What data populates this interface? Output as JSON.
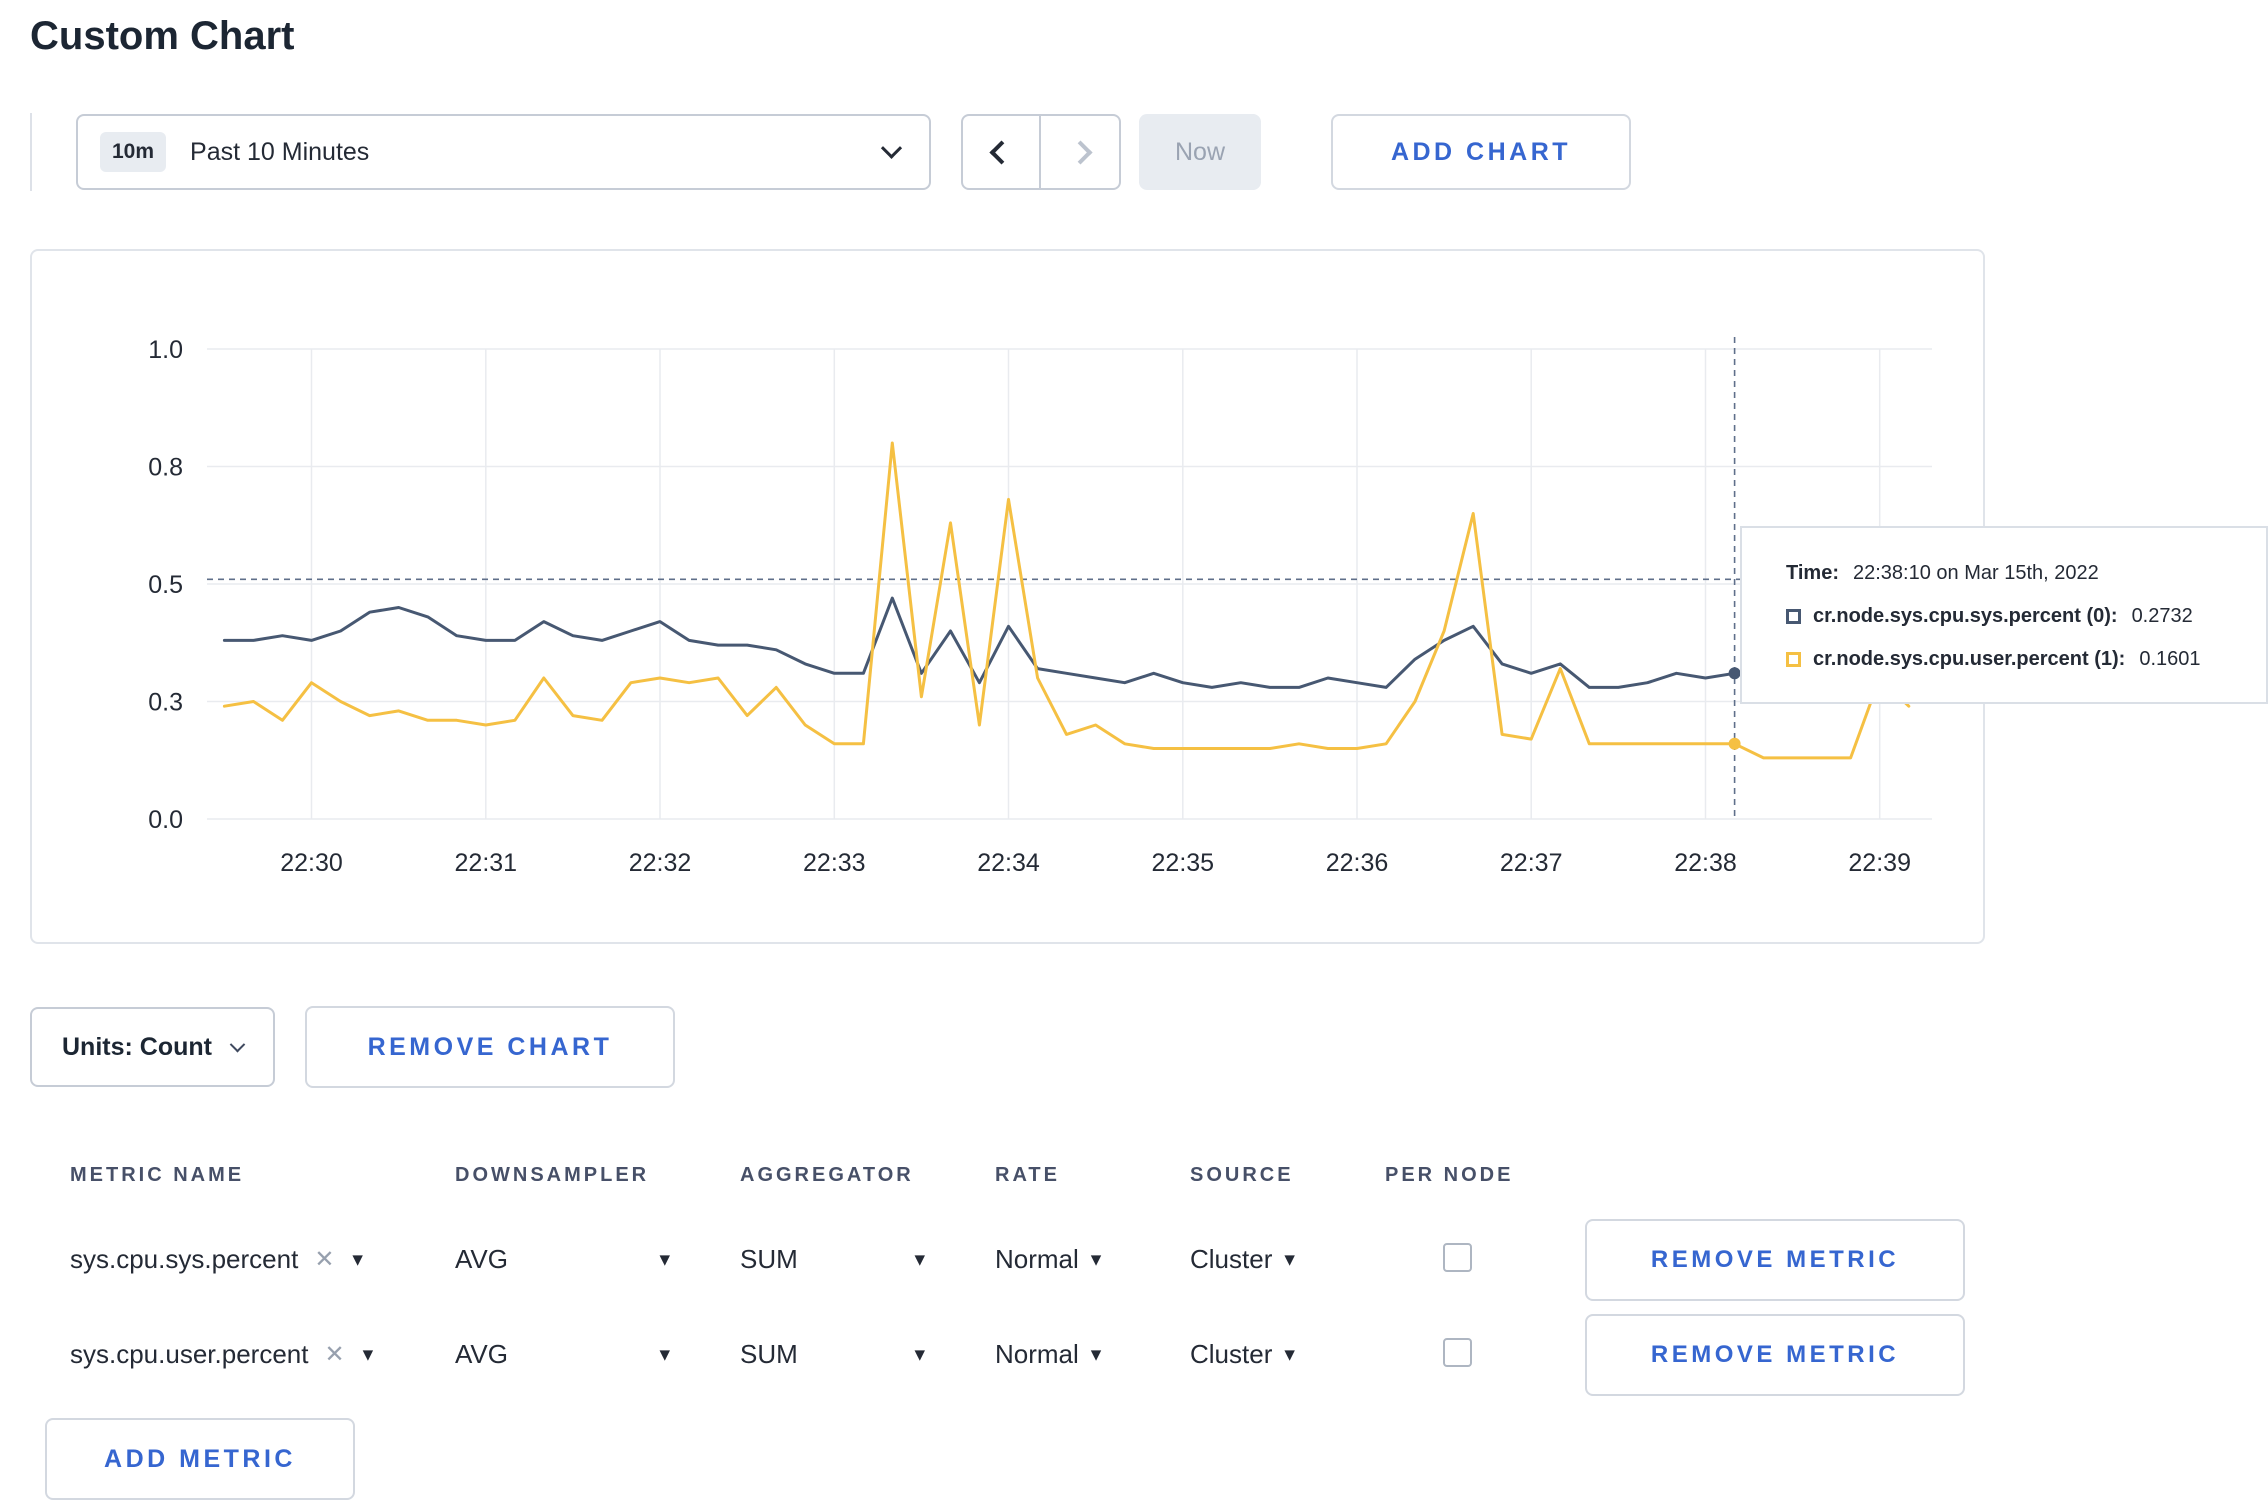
{
  "page": {
    "title": "Custom Chart"
  },
  "toolbar": {
    "time_range": {
      "badge": "10m",
      "label": "Past 10 Minutes"
    },
    "now_label": "Now",
    "add_chart_label": "ADD CHART"
  },
  "chart_data": {
    "type": "line",
    "title": "",
    "xlabel": "",
    "ylabel": "",
    "ylim": [
      0,
      1
    ],
    "x_domain_minutes": [
      -0.6,
      9.3
    ],
    "x_ticks": [
      "22:30",
      "22:31",
      "22:32",
      "22:33",
      "22:34",
      "22:35",
      "22:36",
      "22:37",
      "22:38",
      "22:39"
    ],
    "y_ticks": [
      "0.0",
      "0.3",
      "0.5",
      "0.8",
      "1.0"
    ],
    "grid": true,
    "legend_position": "tooltip",
    "series": [
      {
        "name": "cr.node.sys.cpu.sys.percent",
        "color": "#475872",
        "x": [
          -0.5,
          -0.333,
          -0.167,
          0,
          0.167,
          0.333,
          0.5,
          0.667,
          0.833,
          1,
          1.167,
          1.333,
          1.5,
          1.667,
          1.833,
          2,
          2.167,
          2.333,
          2.5,
          2.667,
          2.833,
          3,
          3.167,
          3.333,
          3.5,
          3.667,
          3.833,
          4,
          4.167,
          4.333,
          4.5,
          4.667,
          4.833,
          5,
          5.167,
          5.333,
          5.5,
          5.667,
          5.833,
          6,
          6.167,
          6.333,
          6.5,
          6.667,
          6.833,
          7,
          7.167,
          7.333,
          7.5,
          7.667,
          7.833,
          8,
          8.167
        ],
        "values": [
          0.38,
          0.38,
          0.39,
          0.38,
          0.4,
          0.44,
          0.45,
          0.43,
          0.39,
          0.38,
          0.38,
          0.42,
          0.39,
          0.38,
          0.4,
          0.42,
          0.38,
          0.37,
          0.37,
          0.36,
          0.33,
          0.31,
          0.31,
          0.47,
          0.31,
          0.4,
          0.29,
          0.41,
          0.32,
          0.31,
          0.3,
          0.29,
          0.31,
          0.29,
          0.28,
          0.29,
          0.28,
          0.28,
          0.3,
          0.29,
          0.28,
          0.34,
          0.38,
          0.41,
          0.33,
          0.31,
          0.33,
          0.28,
          0.28,
          0.29,
          0.31,
          0.3,
          0.31
        ]
      },
      {
        "name": "cr.node.sys.cpu.user.percent",
        "color": "#f5c043",
        "x": [
          -0.5,
          -0.333,
          -0.167,
          0,
          0.167,
          0.333,
          0.5,
          0.667,
          0.833,
          1,
          1.167,
          1.333,
          1.5,
          1.667,
          1.833,
          2,
          2.167,
          2.333,
          2.5,
          2.667,
          2.833,
          3,
          3.167,
          3.333,
          3.5,
          3.667,
          3.833,
          4,
          4.167,
          4.333,
          4.5,
          4.667,
          4.833,
          5,
          5.167,
          5.333,
          5.5,
          5.667,
          5.833,
          6,
          6.167,
          6.333,
          6.5,
          6.667,
          6.833,
          7,
          7.167,
          7.333,
          7.5,
          7.667,
          7.833,
          8,
          8.167,
          8.333,
          8.5,
          8.667,
          8.833,
          9,
          9.167
        ],
        "values": [
          0.24,
          0.25,
          0.21,
          0.29,
          0.25,
          0.22,
          0.23,
          0.21,
          0.21,
          0.2,
          0.21,
          0.3,
          0.22,
          0.21,
          0.29,
          0.3,
          0.29,
          0.3,
          0.22,
          0.28,
          0.2,
          0.16,
          0.16,
          0.8,
          0.26,
          0.63,
          0.2,
          0.68,
          0.3,
          0.18,
          0.2,
          0.16,
          0.15,
          0.15,
          0.15,
          0.15,
          0.15,
          0.16,
          0.15,
          0.15,
          0.16,
          0.25,
          0.4,
          0.65,
          0.18,
          0.17,
          0.32,
          0.16,
          0.16,
          0.16,
          0.16,
          0.16,
          0.16,
          0.13,
          0.13,
          0.13,
          0.13,
          0.3,
          0.24
        ]
      }
    ],
    "cursor": {
      "x_minutes": 8.167,
      "hline_value": 0.51,
      "dots": [
        {
          "x": 8.167,
          "v": 0.31,
          "color": "#475872"
        },
        {
          "x": 8.167,
          "v": 0.16,
          "color": "#f5c043"
        }
      ]
    }
  },
  "tooltip": {
    "time_label": "Time:",
    "time_value": "22:38:10 on Mar 15th, 2022",
    "series": [
      {
        "label": "cr.node.sys.cpu.sys.percent (0):",
        "value": "0.2732",
        "color": "#475872"
      },
      {
        "label": "cr.node.sys.cpu.user.percent (1):",
        "value": "0.1601",
        "color": "#f5c043"
      }
    ]
  },
  "chart_controls": {
    "units_label": "Units: Count",
    "remove_chart_label": "REMOVE CHART"
  },
  "metrics_table": {
    "headers": [
      "METRIC NAME",
      "DOWNSAMPLER",
      "AGGREGATOR",
      "RATE",
      "SOURCE",
      "PER NODE"
    ],
    "rows": [
      {
        "metric": "sys.cpu.sys.percent",
        "downsampler": "AVG",
        "aggregator": "SUM",
        "rate": "Normal",
        "source": "Cluster",
        "per_node": false,
        "remove_label": "REMOVE METRIC"
      },
      {
        "metric": "sys.cpu.user.percent",
        "downsampler": "AVG",
        "aggregator": "SUM",
        "rate": "Normal",
        "source": "Cluster",
        "per_node": false,
        "remove_label": "REMOVE METRIC"
      }
    ],
    "add_metric_label": "ADD METRIC"
  }
}
